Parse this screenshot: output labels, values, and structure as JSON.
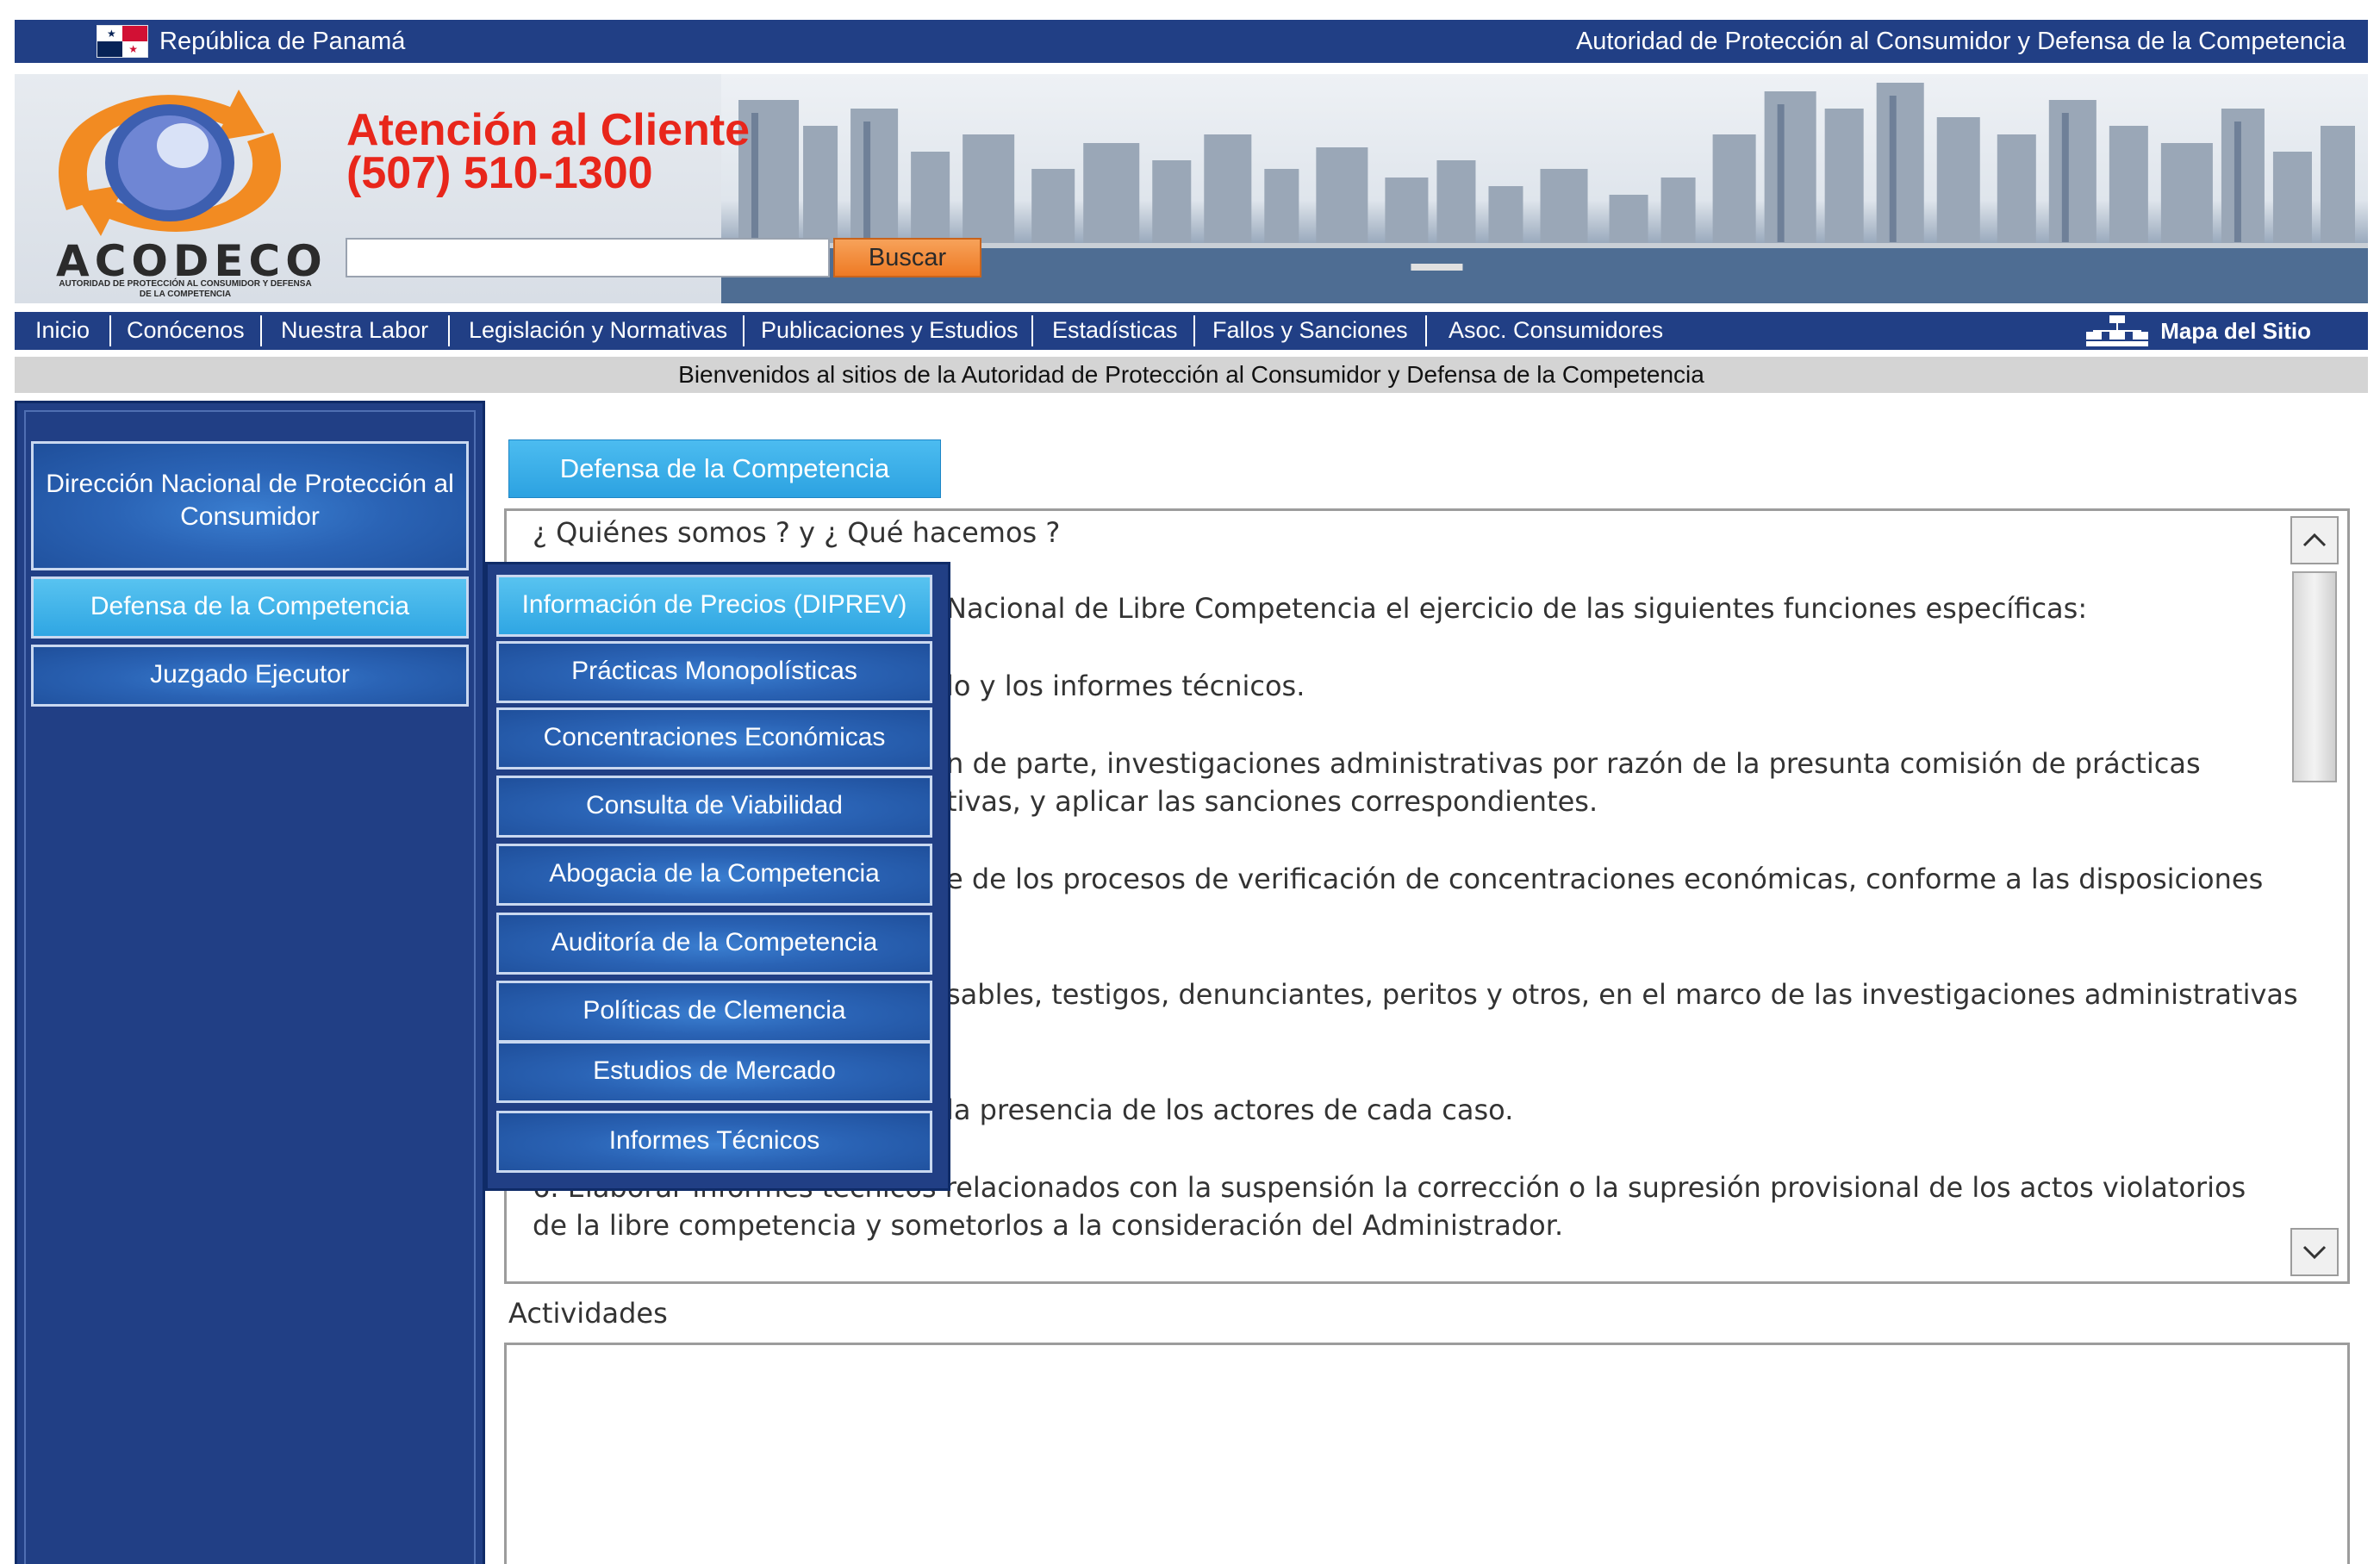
{
  "top_bar": {
    "country": "República de Panamá",
    "authority": "Autoridad de Protección al Consumidor y Defensa de la Competencia"
  },
  "header": {
    "logo_name": "ACODECO",
    "logo_sub": "AUTORIDAD DE PROTECCIÓN AL CONSUMIDOR Y DEFENSA DE LA COMPETENCIA",
    "contact_line1": "Atención al Cliente",
    "contact_line2": "(507) 510-1300",
    "search_placeholder": "",
    "search_button": "Buscar"
  },
  "nav": {
    "items": [
      {
        "label": "Inicio"
      },
      {
        "label": "Conócenos"
      },
      {
        "label": "Nuestra Labor"
      },
      {
        "label": "Legislación y Normativas"
      },
      {
        "label": "Publicaciones y Estudios"
      },
      {
        "label": "Estadísticas"
      },
      {
        "label": "Fallos y Sanciones"
      },
      {
        "label": "Asoc. Consumidores"
      }
    ],
    "sitemap_label": "Mapa del Sitio"
  },
  "welcome": "Bienvenidos al sitios de la Autoridad de Protección al Consumidor y Defensa de la Competencia",
  "sidebar": {
    "items": [
      {
        "label": "Dirección Nacional de Protección al Consumidor",
        "active": false
      },
      {
        "label": "Defensa de la Competencia",
        "active": true
      },
      {
        "label": "Juzgado Ejecutor",
        "active": false
      }
    ]
  },
  "submenu": {
    "items": [
      {
        "label": "Información de Precios (DIPREV)",
        "active": true
      },
      {
        "label": "Prácticas Monopolísticas",
        "active": false
      },
      {
        "label": "Concentraciones Económicas",
        "active": false
      },
      {
        "label": "Consulta de Viabilidad",
        "active": false
      },
      {
        "label": "Abogacia de la Competencia",
        "active": false
      },
      {
        "label": "Auditoría de la Competencia",
        "active": false
      },
      {
        "label": "Políticas de Clemencia",
        "active": false
      },
      {
        "label": "Estudios de Mercado",
        "active": false
      },
      {
        "label": "Informes Técnicos",
        "active": false
      }
    ]
  },
  "content": {
    "tab_label": "Defensa de la Competencia",
    "lines": [
      "¿ Quiénes somos ?  y  ¿ Qué hacemos ?",
      "Nacional de Libre Competencia el ejercicio de las siguientes funciones específicas:",
      "lo y los informes técnicos.",
      "n de parte, investigaciones administrativas por razón de la presunta comisión de prácticas",
      "tivas, y aplicar las sanciones correspondientes.",
      "e de los procesos de verificación de concentraciones económicas, conforme a las disposiciones",
      "sables, testigos, denunciantes, peritos y otros, en el marco de las investigaciones administrativas",
      "la presencia de los actores de cada caso.",
      "6. Elaborar informes técnicos relacionados con la suspensión la corrección o la supresión provisional de los actos violatorios",
      "de la libre competencia y sometorlos a la consideración del Administrador."
    ],
    "activities_label": "Actividades"
  },
  "colors": {
    "navy": "#213f85",
    "accent_blue": "#2fa6e3",
    "contact_red": "#e8261b",
    "search_orange": "#ee7a24"
  }
}
